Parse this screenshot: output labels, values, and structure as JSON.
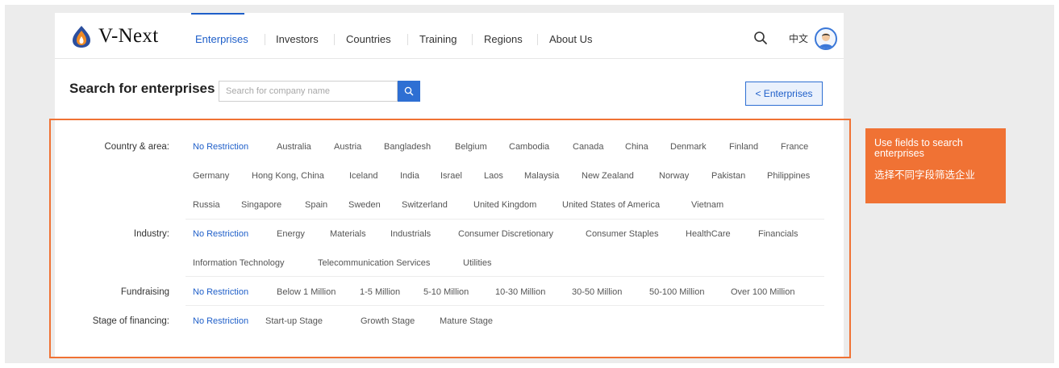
{
  "header": {
    "logo_text": "V-Next",
    "tabs": [
      "Enterprises",
      "Investors",
      "Countries",
      "Training",
      "Regions",
      "About Us"
    ],
    "active_tab": "Enterprises",
    "language": "中文"
  },
  "search": {
    "title": "Search for enterprises",
    "placeholder": "Search for company name",
    "button_icon": "search-icon",
    "back_button": "< Enterprises"
  },
  "filters": {
    "country": {
      "label": "Country & area:",
      "options": [
        "No Restriction",
        "Australia",
        "Austria",
        "Bangladesh",
        "Belgium",
        "Cambodia",
        "Canada",
        "China",
        "Denmark",
        "Finland",
        "France",
        "Germany",
        "Hong Kong, China",
        "Iceland",
        "India",
        "Israel",
        "Laos",
        "Malaysia",
        "New Zealand",
        "Norway",
        "Pakistan",
        "Philippines",
        "Russia",
        "Singapore",
        "Spain",
        "Sweden",
        "Switzerland",
        "United Kingdom",
        "United States of America",
        "Vietnam"
      ]
    },
    "industry": {
      "label": "Industry:",
      "options": [
        "No Restriction",
        "Energy",
        "Materials",
        "Industrials",
        "Consumer Discretionary",
        "Consumer Staples",
        "HealthCare",
        "Financials",
        "Information Technology",
        "Telecommunication Services",
        "Utilities"
      ]
    },
    "fundraising": {
      "label": "Fundraising",
      "options": [
        "No Restriction",
        "Below 1 Million",
        "1-5 Million",
        "5-10 Million",
        "10-30 Million",
        "30-50 Million",
        "50-100 Million",
        "Over 100 Million"
      ]
    },
    "stage": {
      "label": "Stage of financing:",
      "options": [
        "No Restriction",
        "Start-up Stage",
        "Growth Stage",
        "Mature Stage"
      ]
    },
    "selected": "No Restriction"
  },
  "callout": {
    "text_en": "Use fields to search enterprises",
    "text_zh": "选择不同字段筛选企业"
  },
  "colors": {
    "accent": "#1f5fc9",
    "callout": "#f07234",
    "background": "#ececec"
  }
}
